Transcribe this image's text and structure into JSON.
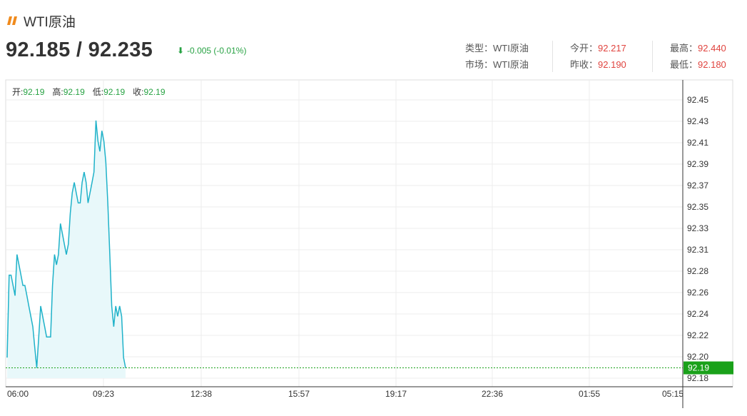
{
  "header": {
    "title": "WTI原油"
  },
  "quote": {
    "bid": "92.185",
    "slash": "/",
    "ask": "92.235",
    "change": "-0.005 (-0.01%)",
    "arrow": "⬇"
  },
  "info": {
    "type_label": "类型：",
    "type_value": "WTI原油",
    "market_label": "市场：",
    "market_value": "WTI原油",
    "open_label": "今开：",
    "open_value": "92.217",
    "prevclose_label": "昨收：",
    "prevclose_value": "92.190",
    "high_label": "最高：",
    "high_value": "92.440",
    "low_label": "最低：",
    "low_value": "92.180"
  },
  "ohlc": {
    "open_label": "开:",
    "open_value": "92.19",
    "high_label": "高:",
    "high_value": "92.19",
    "low_label": "低:",
    "low_value": "92.19",
    "close_label": "收:",
    "close_value": "92.19"
  },
  "colors": {
    "line": "#1fb2c9",
    "fill": "#e8f8fa",
    "up": "#27a243",
    "down": "#e0443f",
    "current": "#1aa11a"
  },
  "chart_data": {
    "type": "area",
    "x_ticks": [
      "06:00",
      "09:23",
      "12:38",
      "15:57",
      "19:17",
      "22:36",
      "01:55",
      "05:15"
    ],
    "y_ticks": [
      "92.45",
      "92.43",
      "92.41",
      "92.39",
      "92.37",
      "92.35",
      "92.33",
      "92.31",
      "92.28",
      "92.26",
      "92.24",
      "92.22",
      "92.20",
      "92.18"
    ],
    "ylim": [
      92.18,
      92.45
    ],
    "current_value": "92.19",
    "grid": true,
    "series": [
      {
        "values": [
          92.2,
          92.28,
          92.28,
          92.27,
          92.26,
          92.3,
          92.29,
          92.28,
          92.27,
          92.27,
          92.26,
          92.25,
          92.24,
          92.23,
          92.21,
          92.19,
          92.22,
          92.25,
          92.24,
          92.23,
          92.22,
          92.22,
          92.22,
          92.27,
          92.3,
          92.29,
          92.3,
          92.33,
          92.32,
          92.31,
          92.3,
          92.31,
          92.34,
          92.36,
          92.37,
          92.36,
          92.35,
          92.35,
          92.37,
          92.38,
          92.37,
          92.35,
          92.36,
          92.37,
          92.38,
          92.43,
          92.41,
          92.4,
          92.42,
          92.41,
          92.39,
          92.35,
          92.3,
          92.25,
          92.23,
          92.25,
          92.24,
          92.25,
          92.24,
          92.2,
          92.19
        ]
      }
    ]
  }
}
